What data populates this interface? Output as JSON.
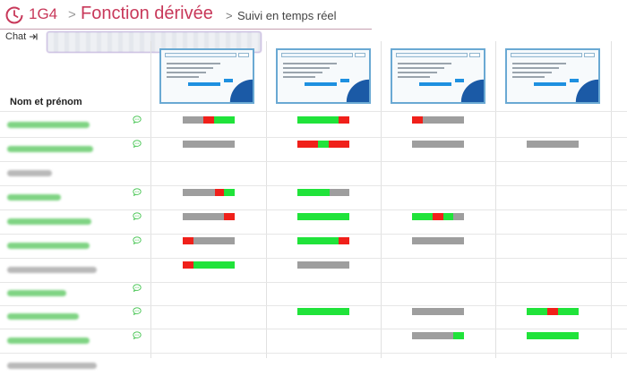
{
  "header": {
    "class_name": "1G4",
    "separator": ">",
    "activity_title": "Fonction dérivée",
    "page_title": "Suivi en temps réel"
  },
  "chat": {
    "label": "Chat"
  },
  "table": {
    "name_column_header": "Nom et prénom",
    "question_count": 4,
    "students": [
      {
        "name_color": "green",
        "chat": true,
        "progress": [
          [
            [
              "x",
              0.4
            ],
            [
              "r",
              0.2
            ],
            [
              "g",
              0.4
            ]
          ],
          [
            [
              "g",
              0.8
            ],
            [
              "r",
              0.2
            ]
          ],
          [
            [
              "r",
              0.2
            ],
            [
              "x",
              0.8
            ]
          ],
          null
        ]
      },
      {
        "name_color": "green",
        "chat": true,
        "progress": [
          [
            [
              "x",
              1.0
            ]
          ],
          [
            [
              "r",
              0.4
            ],
            [
              "g",
              0.2
            ],
            [
              "r",
              0.4
            ]
          ],
          [
            [
              "x",
              1.0
            ]
          ],
          [
            [
              "x",
              1.0
            ]
          ]
        ]
      },
      {
        "name_color": "gray",
        "chat": false,
        "progress": [
          null,
          null,
          null,
          null
        ]
      },
      {
        "name_color": "green",
        "chat": true,
        "progress": [
          [
            [
              "x",
              0.62
            ],
            [
              "r",
              0.18
            ],
            [
              "g",
              0.2
            ]
          ],
          [
            [
              "g",
              0.62
            ],
            [
              "x",
              0.38
            ]
          ],
          null,
          null
        ]
      },
      {
        "name_color": "green",
        "chat": true,
        "progress": [
          [
            [
              "x",
              0.8
            ],
            [
              "r",
              0.2
            ]
          ],
          [
            [
              "g",
              1.0
            ]
          ],
          [
            [
              "g",
              0.4
            ],
            [
              "r",
              0.2
            ],
            [
              "g",
              0.2
            ],
            [
              "x",
              0.2
            ]
          ],
          null
        ]
      },
      {
        "name_color": "green",
        "chat": true,
        "progress": [
          [
            [
              "r",
              0.2
            ],
            [
              "x",
              0.8
            ]
          ],
          [
            [
              "g",
              0.8
            ],
            [
              "r",
              0.2
            ]
          ],
          [
            [
              "x",
              1.0
            ]
          ],
          null
        ]
      },
      {
        "name_color": "gray",
        "chat": false,
        "progress": [
          [
            [
              "r",
              0.2
            ],
            [
              "g",
              0.8
            ]
          ],
          [
            [
              "x",
              1.0
            ]
          ],
          null,
          null
        ]
      },
      {
        "name_color": "green",
        "chat": true,
        "progress": [
          null,
          null,
          null,
          null
        ]
      },
      {
        "name_color": "green",
        "chat": true,
        "progress": [
          null,
          [
            [
              "g",
              1.0
            ]
          ],
          [
            [
              "x",
              1.0
            ]
          ],
          [
            [
              "g",
              0.4
            ],
            [
              "r",
              0.2
            ],
            [
              "g",
              0.4
            ]
          ]
        ]
      },
      {
        "name_color": "green",
        "chat": true,
        "progress": [
          null,
          null,
          [
            [
              "x",
              0.8
            ],
            [
              "g",
              0.2
            ]
          ],
          [
            [
              "g",
              1.0
            ]
          ]
        ]
      },
      {
        "name_color": "gray",
        "chat": false,
        "progress": [
          null,
          null,
          null,
          null
        ]
      }
    ]
  },
  "colors": {
    "accent": "#c8385a",
    "success": "#20e33a",
    "error": "#f0201a",
    "pending": "#9e9e9e",
    "thumbnail_border": "#6aa9d3"
  },
  "icons": {
    "clock": "clock-icon",
    "chat_toggle": "arrow-right-to-bar-icon",
    "student_chat": "chat-bubble-icon"
  }
}
